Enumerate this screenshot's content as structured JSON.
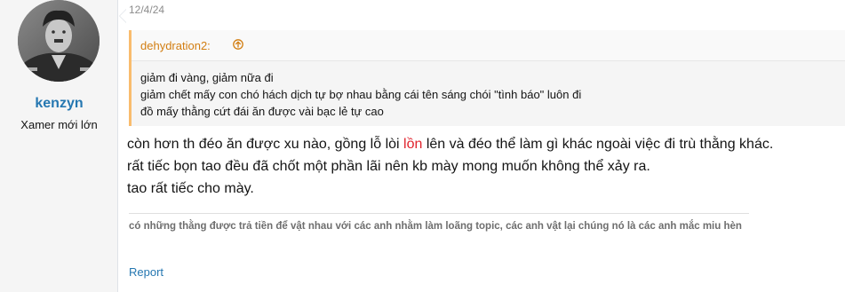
{
  "post": {
    "date": "12/4/24",
    "user": {
      "name": "kenzyn",
      "title": "Xamer mới lớn"
    },
    "quote": {
      "author": "dehydration2:",
      "lines": [
        "giảm đi vàng, giảm nữa đi",
        "giảm chết mấy con chó hách dịch tự bợ nhau bằng cái tên sáng chói \"tình báo\" luôn đi",
        "đồ mấy thằng cứt đái ăn được vài bạc lẻ tự cao"
      ]
    },
    "message": {
      "line1_before": "còn hơn th đéo ăn được xu nào, gồng lỗ lòi ",
      "line1_highlight": "lồn",
      "line1_after": " lên và đéo thể làm gì khác ngoài việc đi trù thằng khác.",
      "line2": "rất tiếc bọn tao đều đã chốt một phần lãi nên kb mày mong muốn không thể xảy ra.",
      "line3": "tao rất tiếc cho mày."
    },
    "signature": "có những thằng được trả tiền để vật nhau với các anh nhằm làm loãng topic, các anh vật lại chúng nó là các anh mắc miu hèn",
    "report_label": "Report"
  },
  "colors": {
    "link": "#2577b1",
    "quote_accent": "#f9bc6d",
    "quote_author": "#d27e12",
    "highlight": "#e0232d"
  }
}
